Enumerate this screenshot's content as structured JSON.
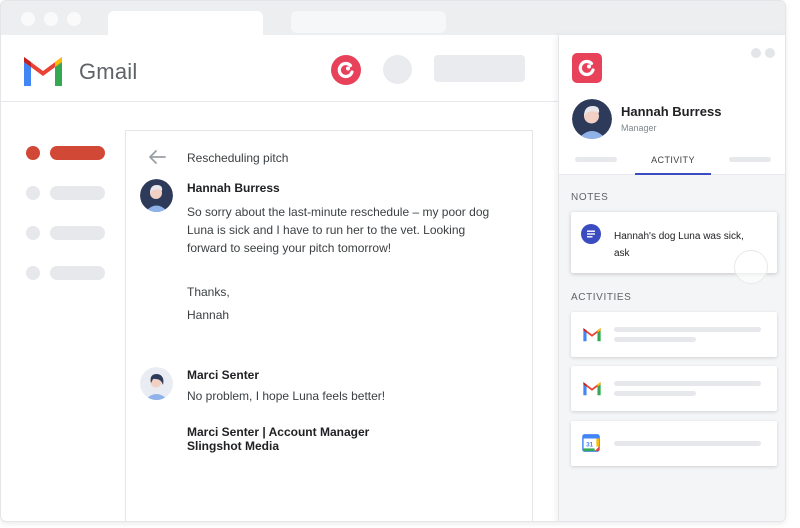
{
  "app": {
    "name": "Gmail"
  },
  "email": {
    "subject": "Rescheduling pitch",
    "messages": [
      {
        "sender": "Hannah Burress",
        "body_lines": [
          "So sorry about the last-minute reschedule – my poor dog",
          "Luna is sick and I have to run her to the vet. Looking",
          "forward to seeing your pitch tomorrow!"
        ],
        "closing": "Thanks,",
        "signoff": "Hannah"
      },
      {
        "sender": "Marci Senter",
        "body": "No problem, I hope Luna feels better!",
        "signature_line1": "Marci Senter | Account Manager",
        "signature_line2": "Slingshot Media"
      }
    ]
  },
  "sidebar": {
    "colors": {
      "active": "#d14836",
      "inactive": "#e6e8eb"
    }
  },
  "copper_panel": {
    "contact": {
      "name": "Hannah Burress",
      "role": "Manager"
    },
    "tabs": {
      "active_label": "ACTIVITY"
    },
    "notes_label": "NOTES",
    "note": "Hannah's dog Luna was sick, ask",
    "activities_label": "ACTIVITIES",
    "activities": [
      {
        "icon": "gmail-icon"
      },
      {
        "icon": "gmail-icon"
      },
      {
        "icon": "google-calendar-icon",
        "calendar_day": "31"
      }
    ],
    "colors": {
      "brand": "#e8415a",
      "accent": "#3b4cc0"
    }
  }
}
